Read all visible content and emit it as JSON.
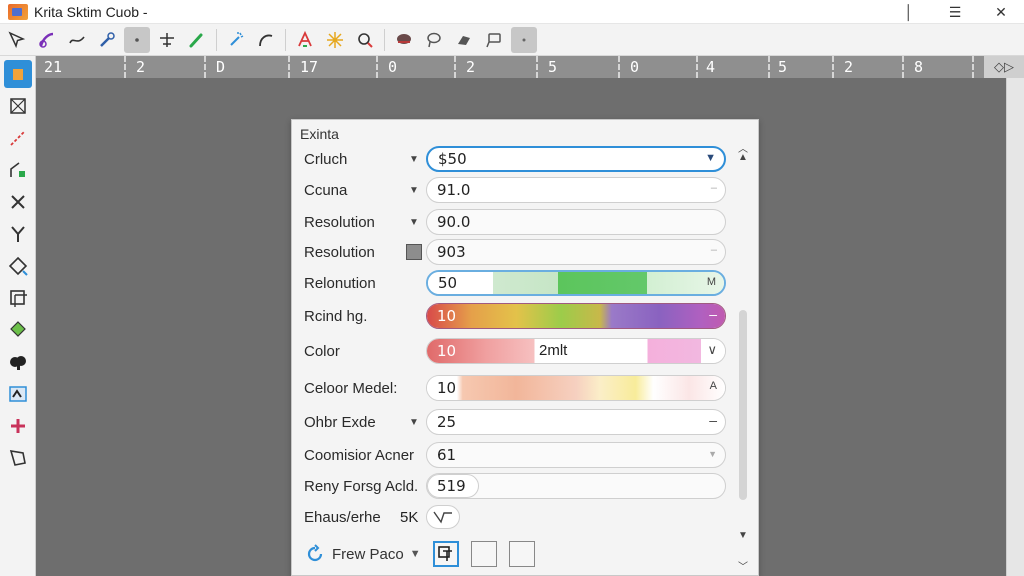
{
  "window": {
    "title": "Krita Sktim Cuob -",
    "controls": [
      "│",
      "☰",
      "✕"
    ]
  },
  "ruler": {
    "marks": [
      "21",
      "2",
      "D",
      "17",
      "0",
      "2",
      "5",
      "0",
      "4",
      "5",
      "2",
      "8"
    ],
    "end_label": "◇▷"
  },
  "dialog": {
    "title": "Exinta",
    "rows": [
      {
        "label": "Crluch",
        "value": "$50",
        "suffix": "▼"
      },
      {
        "label": "Ccuna",
        "value": "91.0",
        "suffix": "–"
      },
      {
        "label": "Resolution",
        "value": "90.0",
        "suffix": ""
      },
      {
        "label": "Resolution",
        "value": "903",
        "suffix": "–"
      },
      {
        "label": "Relonution",
        "value": "50",
        "suffix": "M"
      },
      {
        "label": "Rcind hg.",
        "value": "10",
        "suffix": "–"
      },
      {
        "label": "Color",
        "value": "10",
        "mid": "2mlt",
        "suffix": "∨"
      },
      {
        "label": "Celoor Medel:",
        "value": "10",
        "suffix": "A"
      },
      {
        "label": "Ohbr Exde",
        "value": "25",
        "suffix": "–"
      },
      {
        "label": "Coomisior Acner",
        "value": "61",
        "suffix": "▼"
      },
      {
        "label": "Reny Forsg Acld.",
        "value": "519",
        "suffix": ""
      },
      {
        "label": "Ehaus/erhe",
        "value": "5K",
        "suffix": ""
      }
    ],
    "footer": {
      "label": "Frew Paco",
      "arrow": "▼"
    }
  },
  "colors": {
    "accent": "#2f8fd8",
    "canvas": "#6e6e6e",
    "ruler": "#8f8f8f"
  }
}
